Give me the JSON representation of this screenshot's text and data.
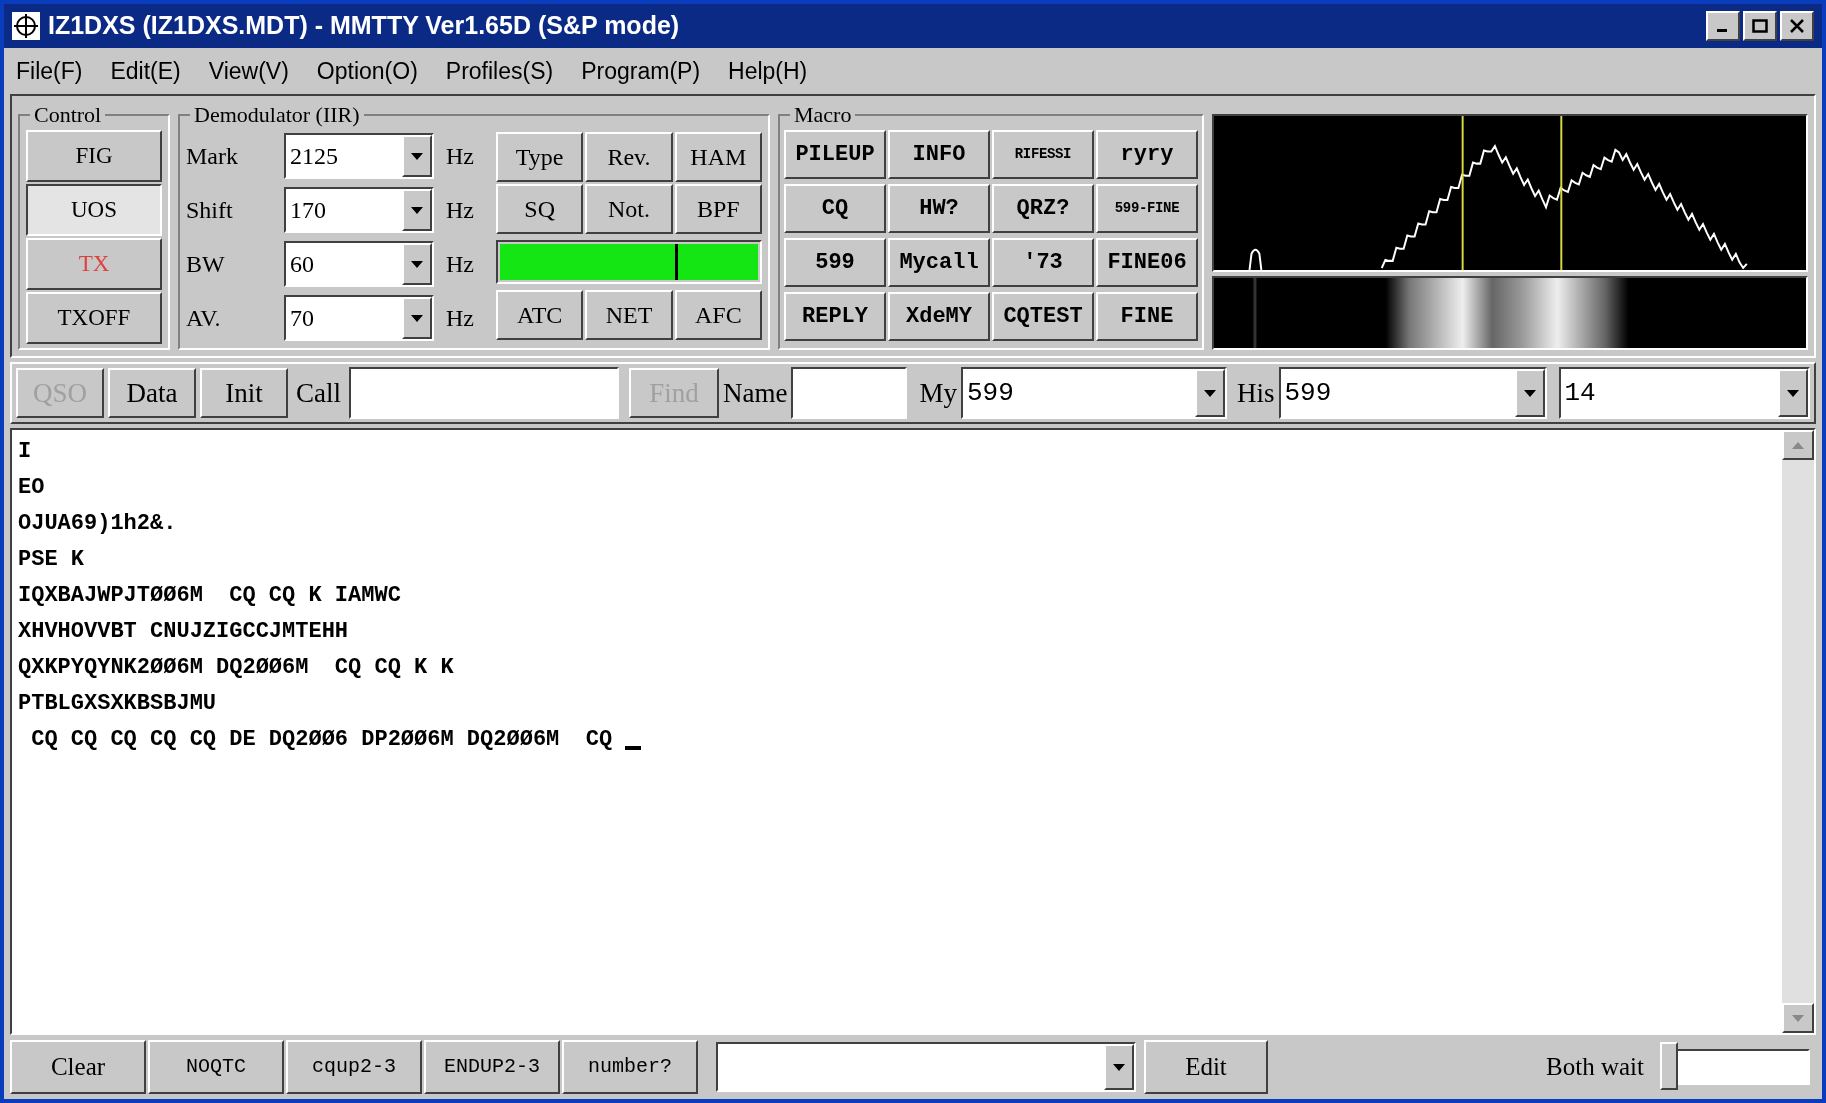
{
  "window": {
    "title": "IZ1DXS (IZ1DXS.MDT) - MMTTY Ver1.65D (S&P mode)"
  },
  "menu": [
    "File(F)",
    "Edit(E)",
    "View(V)",
    "Option(O)",
    "Profiles(S)",
    "Program(P)",
    "Help(H)"
  ],
  "control": {
    "title": "Control",
    "buttons": [
      {
        "label": "FIG",
        "on": false,
        "color": "#000000"
      },
      {
        "label": "UOS",
        "on": true,
        "color": "#000000"
      },
      {
        "label": "TX",
        "on": false,
        "color": "#e04040"
      },
      {
        "label": "TXOFF",
        "on": false,
        "color": "#000000"
      }
    ]
  },
  "demodulator": {
    "title": "Demodulator (IIR)",
    "fields": [
      {
        "label": "Mark",
        "value": "2125",
        "unit": "Hz"
      },
      {
        "label": "Shift",
        "value": "170",
        "unit": "Hz"
      },
      {
        "label": "BW",
        "value": "60",
        "unit": "Hz"
      },
      {
        "label": "AV.",
        "value": "70",
        "unit": "Hz"
      }
    ],
    "top_buttons": [
      "Type",
      "Rev.",
      "HAM",
      "SQ",
      "Not.",
      "BPF"
    ],
    "tuning": {
      "level": 0.68
    },
    "bottom_buttons": [
      "ATC",
      "NET",
      "AFC"
    ]
  },
  "macro": {
    "title": "Macro",
    "buttons": [
      "PILEUP",
      "INFO",
      "RIFESSI",
      "ryry",
      "CQ",
      "HW?",
      "QRZ?",
      "599-FINE",
      "599",
      "Mycall",
      "'73",
      "FINE06",
      "REPLY",
      "XdeMY",
      "CQTEST",
      "FINE"
    ]
  },
  "qso_bar": {
    "buttons": [
      {
        "label": "QSO",
        "disabled": true
      },
      {
        "label": "Data",
        "disabled": false
      },
      {
        "label": "Init",
        "disabled": false
      }
    ],
    "call_label": "Call",
    "find": {
      "label": "Find",
      "disabled": true
    },
    "name_label": "Name",
    "my": {
      "label": "My",
      "value": "599"
    },
    "his": {
      "label": "His",
      "value": "599"
    },
    "band": {
      "value": "14"
    }
  },
  "receive_text": {
    "lines": [
      "I",
      "EO",
      "OJUA69)1h2&.",
      "PSE K",
      "IQXBAJWPJTØØ6M  CQ CQ K IAMWC",
      "XHVHOVVBT CNUJZIGCCJMTEHH",
      "QXKPYQYNK2ØØ6M DQ2ØØ6M  CQ CQ K K",
      "PTBLGXSXKBSBJMU",
      " CQ CQ CQ CQ CQ DE DQ2ØØ6 DP2ØØ6M DQ2ØØ6M  CQ "
    ]
  },
  "bottom_bar": {
    "buttons": [
      "Clear",
      "NOQTC",
      "cqup2-3",
      "ENDUP2-3",
      "number?"
    ],
    "edit_button": "Edit",
    "wait": {
      "label": "Both wait",
      "level": 0
    }
  }
}
